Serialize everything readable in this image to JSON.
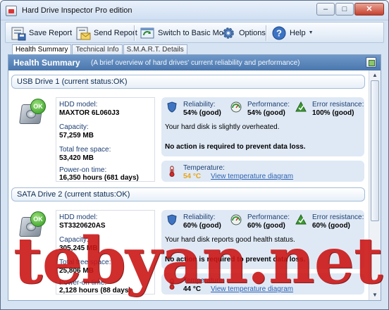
{
  "window": {
    "title": "Hard Drive Inspector Pro edition",
    "controls": {
      "minimize": "–",
      "maximize": "□",
      "close": "✕"
    }
  },
  "toolbar": {
    "save_report": "Save Report",
    "send_report": "Send Report",
    "switch_mode": "Switch to Basic Mode",
    "options": "Options",
    "help": "Help"
  },
  "tabs": [
    "Health Summary",
    "Technical Info",
    "S.M.A.R.T. Details"
  ],
  "summary": {
    "title": "Health Summary",
    "subtitle": "(A brief overview of hard drives' current reliability and performance)"
  },
  "labels": {
    "model": "HDD model:",
    "capacity": "Capacity:",
    "free_space": "Total free space:",
    "power_on": "Power-on time:",
    "reliability": "Reliability:",
    "performance": "Performance:",
    "error_resistance": "Error resistance:",
    "temperature": "Temperature:",
    "view_temp": "View temperature diagram",
    "ok": "OK"
  },
  "drives": [
    {
      "title": "USB Drive 1 (current status:OK)",
      "model": "MAXTOR 6L060J3",
      "capacity": "57,259 MB",
      "free_space": "53,420 MB",
      "power_on": "16,350 hours (681 days)",
      "reliability": "54% (good)",
      "performance": "54% (good)",
      "error_resistance": "100% (good)",
      "note": "Your hard disk is slightly overheated.",
      "action": "No action is required to prevent data loss.",
      "temperature": "54 °C",
      "temperature_color": "#e8a317"
    },
    {
      "title": "SATA Drive 2 (current status:OK)",
      "model": "ST3320620AS",
      "capacity": "305,245 MB",
      "free_space": "25,806 MB",
      "power_on": "2,128 hours (88 days)",
      "reliability": "60% (good)",
      "performance": "60% (good)",
      "error_resistance": "60% (good)",
      "note": "Your hard disk reports good health status.",
      "action": "No action is required to prevent data loss.",
      "temperature": "44 °C",
      "temperature_color": "#000000"
    }
  ],
  "watermark": "tebyan.net",
  "colors": {
    "header_blue": "#4a77ae",
    "card_bg": "#dfe9f5",
    "link": "#2f63b0",
    "ok_green": "#2e9a1f",
    "watermark_red": "#cc1717"
  },
  "icons": [
    "save-report-icon",
    "send-report-icon",
    "switch-mode-icon",
    "options-gear-icon",
    "help-icon",
    "shield-icon",
    "gauge-icon",
    "warning-triangle-icon",
    "thermometer-icon"
  ]
}
